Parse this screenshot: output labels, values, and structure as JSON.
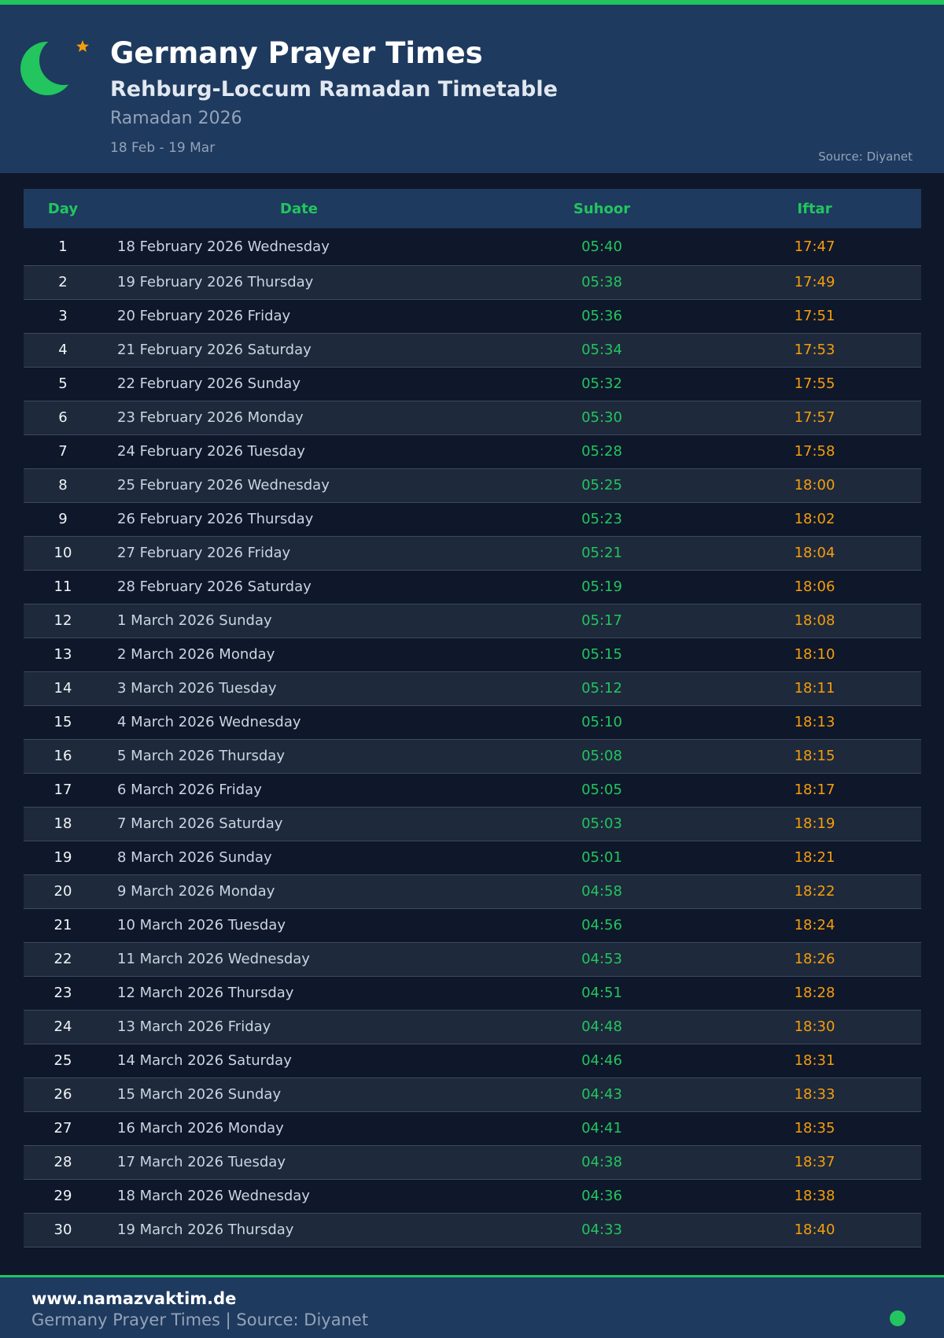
{
  "header": {
    "title": "Germany Prayer Times",
    "subtitle": "Rehburg-Loccum Ramadan Timetable",
    "season": "Ramadan 2026",
    "range": "18 Feb - 19 Mar",
    "source": "Source: Diyanet"
  },
  "icons": {
    "moon": "crescent-moon-icon",
    "star": "star-icon",
    "status": "status-dot-icon"
  },
  "colors": {
    "accent": "#22c55e",
    "iftar": "#f59e0b",
    "header_bg": "#1e3a5f",
    "page_bg": "#0f172a"
  },
  "table": {
    "headers": {
      "day": "Day",
      "date": "Date",
      "suhoor": "Suhoor",
      "iftar": "Iftar"
    },
    "rows": [
      {
        "day": "1",
        "date": "18 February 2026 Wednesday",
        "suhoor": "05:40",
        "iftar": "17:47"
      },
      {
        "day": "2",
        "date": "19 February 2026 Thursday",
        "suhoor": "05:38",
        "iftar": "17:49"
      },
      {
        "day": "3",
        "date": "20 February 2026 Friday",
        "suhoor": "05:36",
        "iftar": "17:51"
      },
      {
        "day": "4",
        "date": "21 February 2026 Saturday",
        "suhoor": "05:34",
        "iftar": "17:53"
      },
      {
        "day": "5",
        "date": "22 February 2026 Sunday",
        "suhoor": "05:32",
        "iftar": "17:55"
      },
      {
        "day": "6",
        "date": "23 February 2026 Monday",
        "suhoor": "05:30",
        "iftar": "17:57"
      },
      {
        "day": "7",
        "date": "24 February 2026 Tuesday",
        "suhoor": "05:28",
        "iftar": "17:58"
      },
      {
        "day": "8",
        "date": "25 February 2026 Wednesday",
        "suhoor": "05:25",
        "iftar": "18:00"
      },
      {
        "day": "9",
        "date": "26 February 2026 Thursday",
        "suhoor": "05:23",
        "iftar": "18:02"
      },
      {
        "day": "10",
        "date": "27 February 2026 Friday",
        "suhoor": "05:21",
        "iftar": "18:04"
      },
      {
        "day": "11",
        "date": "28 February 2026 Saturday",
        "suhoor": "05:19",
        "iftar": "18:06"
      },
      {
        "day": "12",
        "date": "1 March 2026 Sunday",
        "suhoor": "05:17",
        "iftar": "18:08"
      },
      {
        "day": "13",
        "date": "2 March 2026 Monday",
        "suhoor": "05:15",
        "iftar": "18:10"
      },
      {
        "day": "14",
        "date": "3 March 2026 Tuesday",
        "suhoor": "05:12",
        "iftar": "18:11"
      },
      {
        "day": "15",
        "date": "4 March 2026 Wednesday",
        "suhoor": "05:10",
        "iftar": "18:13"
      },
      {
        "day": "16",
        "date": "5 March 2026 Thursday",
        "suhoor": "05:08",
        "iftar": "18:15"
      },
      {
        "day": "17",
        "date": "6 March 2026 Friday",
        "suhoor": "05:05",
        "iftar": "18:17"
      },
      {
        "day": "18",
        "date": "7 March 2026 Saturday",
        "suhoor": "05:03",
        "iftar": "18:19"
      },
      {
        "day": "19",
        "date": "8 March 2026 Sunday",
        "suhoor": "05:01",
        "iftar": "18:21"
      },
      {
        "day": "20",
        "date": "9 March 2026 Monday",
        "suhoor": "04:58",
        "iftar": "18:22"
      },
      {
        "day": "21",
        "date": "10 March 2026 Tuesday",
        "suhoor": "04:56",
        "iftar": "18:24"
      },
      {
        "day": "22",
        "date": "11 March 2026 Wednesday",
        "suhoor": "04:53",
        "iftar": "18:26"
      },
      {
        "day": "23",
        "date": "12 March 2026 Thursday",
        "suhoor": "04:51",
        "iftar": "18:28"
      },
      {
        "day": "24",
        "date": "13 March 2026 Friday",
        "suhoor": "04:48",
        "iftar": "18:30"
      },
      {
        "day": "25",
        "date": "14 March 2026 Saturday",
        "suhoor": "04:46",
        "iftar": "18:31"
      },
      {
        "day": "26",
        "date": "15 March 2026 Sunday",
        "suhoor": "04:43",
        "iftar": "18:33"
      },
      {
        "day": "27",
        "date": "16 March 2026 Monday",
        "suhoor": "04:41",
        "iftar": "18:35"
      },
      {
        "day": "28",
        "date": "17 March 2026 Tuesday",
        "suhoor": "04:38",
        "iftar": "18:37"
      },
      {
        "day": "29",
        "date": "18 March 2026 Wednesday",
        "suhoor": "04:36",
        "iftar": "18:38"
      },
      {
        "day": "30",
        "date": "19 March 2026 Thursday",
        "suhoor": "04:33",
        "iftar": "18:40"
      }
    ]
  },
  "footer": {
    "site": "www.namazvaktim.de",
    "text": "Germany Prayer Times | Source: Diyanet"
  }
}
